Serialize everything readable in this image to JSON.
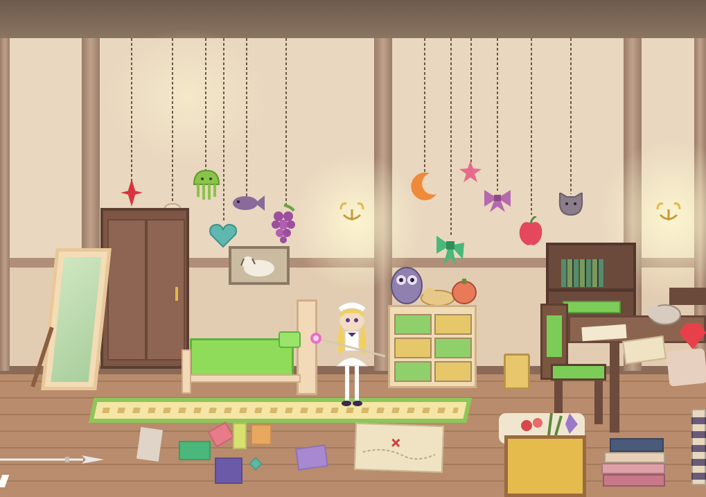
{
  "scene": {
    "room": "bedroom",
    "hanging_ornaments": [
      {
        "icon": "red-diamond-icon",
        "color": "#d8343e"
      },
      {
        "icon": "ghost-icon",
        "color": "#f0dcc4"
      },
      {
        "icon": "green-jellyfish-icon",
        "color": "#8bc24a"
      },
      {
        "icon": "teal-heart-icon",
        "color": "#5fb8b0"
      },
      {
        "icon": "purple-fish-icon",
        "color": "#8a6a9a"
      },
      {
        "icon": "purple-grapes-icon",
        "color": "#9c4f9c"
      },
      {
        "icon": "orange-moon-icon",
        "color": "#ee8a3a"
      },
      {
        "icon": "green-bow-icon",
        "color": "#49b87a"
      },
      {
        "icon": "pink-star-icon",
        "color": "#e86a8a"
      },
      {
        "icon": "purple-bow-icon",
        "color": "#b56aae"
      },
      {
        "icon": "red-apple-icon",
        "color": "#e3485c"
      },
      {
        "icon": "cat-face-icon",
        "color": "#8c7d8a"
      }
    ],
    "wall_light_icons": [
      "wall-sconce-icon",
      "wall-sconce-icon",
      "wall-sconce-icon"
    ],
    "colors": {
      "wall": "#e9d7bf",
      "floor": "#b88c6c",
      "wood": "#7d5646",
      "bed_sheet": "#8edc5a",
      "accent_green": "#8fc65a"
    }
  },
  "hud": {
    "weapon_icon": "spear-icon"
  }
}
